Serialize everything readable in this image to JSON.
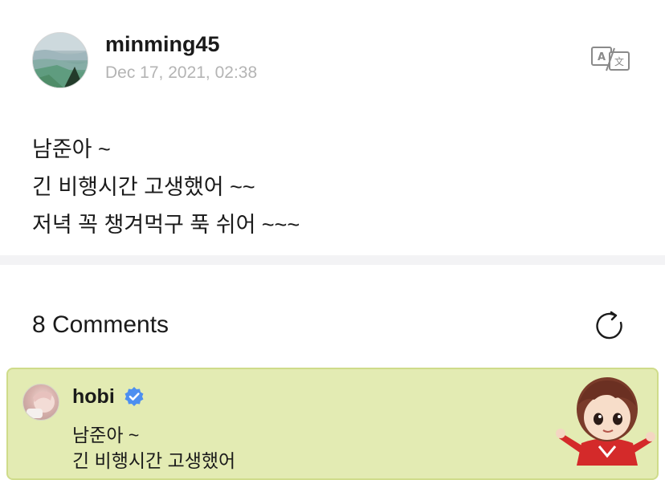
{
  "post": {
    "username": "minming45",
    "timestamp": "Dec 17, 2021, 02:38",
    "lines": [
      "남준아 ~",
      "긴 비행시간 고생했어 ~~",
      "저녁 꼭 챙겨먹구 푹 쉬어 ~~~"
    ],
    "translate_icon": "translate-icon"
  },
  "comments": {
    "title": "8 Comments",
    "refresh_icon": "refresh-icon",
    "items": [
      {
        "author": "hobi",
        "verified": true,
        "lines": [
          "남준아 ~",
          "긴 비행시간 고생했어"
        ],
        "highlight_color": "#e3ebb3",
        "sticker": "character-sticker"
      }
    ]
  },
  "colors": {
    "text": "#1a1a1a",
    "muted": "#b4b4b4",
    "verified": "#4d8ff0",
    "divider": "#f3f3f5",
    "comment_bg": "#e3ebb3",
    "comment_border": "#cfdc8a"
  }
}
